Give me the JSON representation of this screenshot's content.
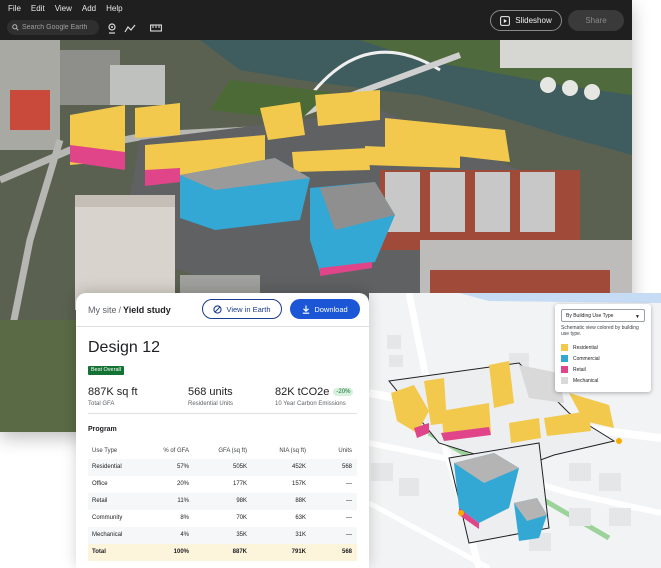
{
  "earth": {
    "menu": [
      "File",
      "Edit",
      "View",
      "Add",
      "Help"
    ],
    "search_placeholder": "Search Google Earth",
    "slideshow_label": "Slideshow",
    "share_label": "Share"
  },
  "card": {
    "breadcrumb_site": "My site",
    "breadcrumb_sep": "/",
    "breadcrumb_study": "Yield study",
    "view_label": "View in Earth",
    "download_label": "Download",
    "design_title": "Design 12",
    "badge": "Best Overall",
    "metrics": [
      {
        "value": "887K sq ft",
        "label": "Total GFA"
      },
      {
        "value": "568 units",
        "label": "Residential Units"
      },
      {
        "value": "82K tCO2e",
        "badge": "-20%",
        "label": "10 Year Carbon Emissions"
      }
    ],
    "program_label": "Program",
    "table": {
      "headers": [
        "Use Type",
        "% of GFA",
        "GFA (sq ft)",
        "NIA (sq ft)",
        "Units"
      ],
      "rows": [
        [
          "Residential",
          "57%",
          "505K",
          "452K",
          "568"
        ],
        [
          "Office",
          "20%",
          "177K",
          "157K",
          "—"
        ],
        [
          "Retail",
          "11%",
          "98K",
          "88K",
          "—"
        ],
        [
          "Community",
          "8%",
          "70K",
          "63K",
          "—"
        ],
        [
          "Mechanical",
          "4%",
          "35K",
          "31K",
          "—"
        ]
      ],
      "total": [
        "Total",
        "100%",
        "887K",
        "791K",
        "568"
      ]
    }
  },
  "legend": {
    "select_value": "By Building Use Type",
    "description": "Schematic view colored by building use type.",
    "items": [
      {
        "label": "Residential",
        "color": "#f2c94c"
      },
      {
        "label": "Commercial",
        "color": "#34a8d4"
      },
      {
        "label": "Retail",
        "color": "#e0458a"
      },
      {
        "label": "Mechanical",
        "color": "#d9d9d9"
      }
    ]
  },
  "colors": {
    "residential": "#f2c94c",
    "commercial": "#34a8d4",
    "retail": "#e0458a",
    "mechanical": "#d9d9d9",
    "accent": "#1a56d6"
  }
}
